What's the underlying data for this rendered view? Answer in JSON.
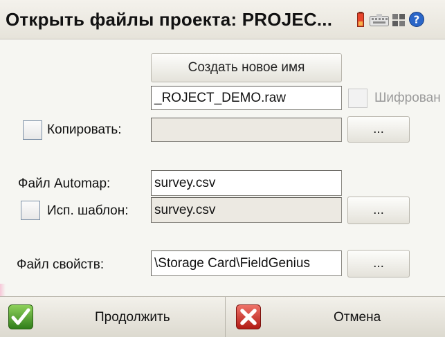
{
  "window": {
    "title": "Открыть файлы проекта: PROJEC..."
  },
  "tray": {
    "icons": [
      "battery-icon",
      "keyboard-icon",
      "apps-icon",
      "help-icon"
    ]
  },
  "form": {
    "create_name_button": "Создать новое имя",
    "project_filename": "_ROJECT_DEMO.raw",
    "encrypt_label": "Шифрован",
    "copy_label": "Копировать:",
    "copy_value": "",
    "browse_label": "...",
    "automap_label": "Файл Automap:",
    "automap_value": "survey.csv",
    "template_label": "Исп. шаблон:",
    "template_value": "survey.csv",
    "properties_label": "Файл свойств:",
    "properties_value": "\\Storage Card\\FieldGenius"
  },
  "footer": {
    "continue_label": "Продолжить",
    "cancel_label": "Отмена"
  },
  "colors": {
    "ok_green": "#4a9a2a",
    "cancel_red": "#d8322c",
    "help_blue": "#2a66c8"
  }
}
